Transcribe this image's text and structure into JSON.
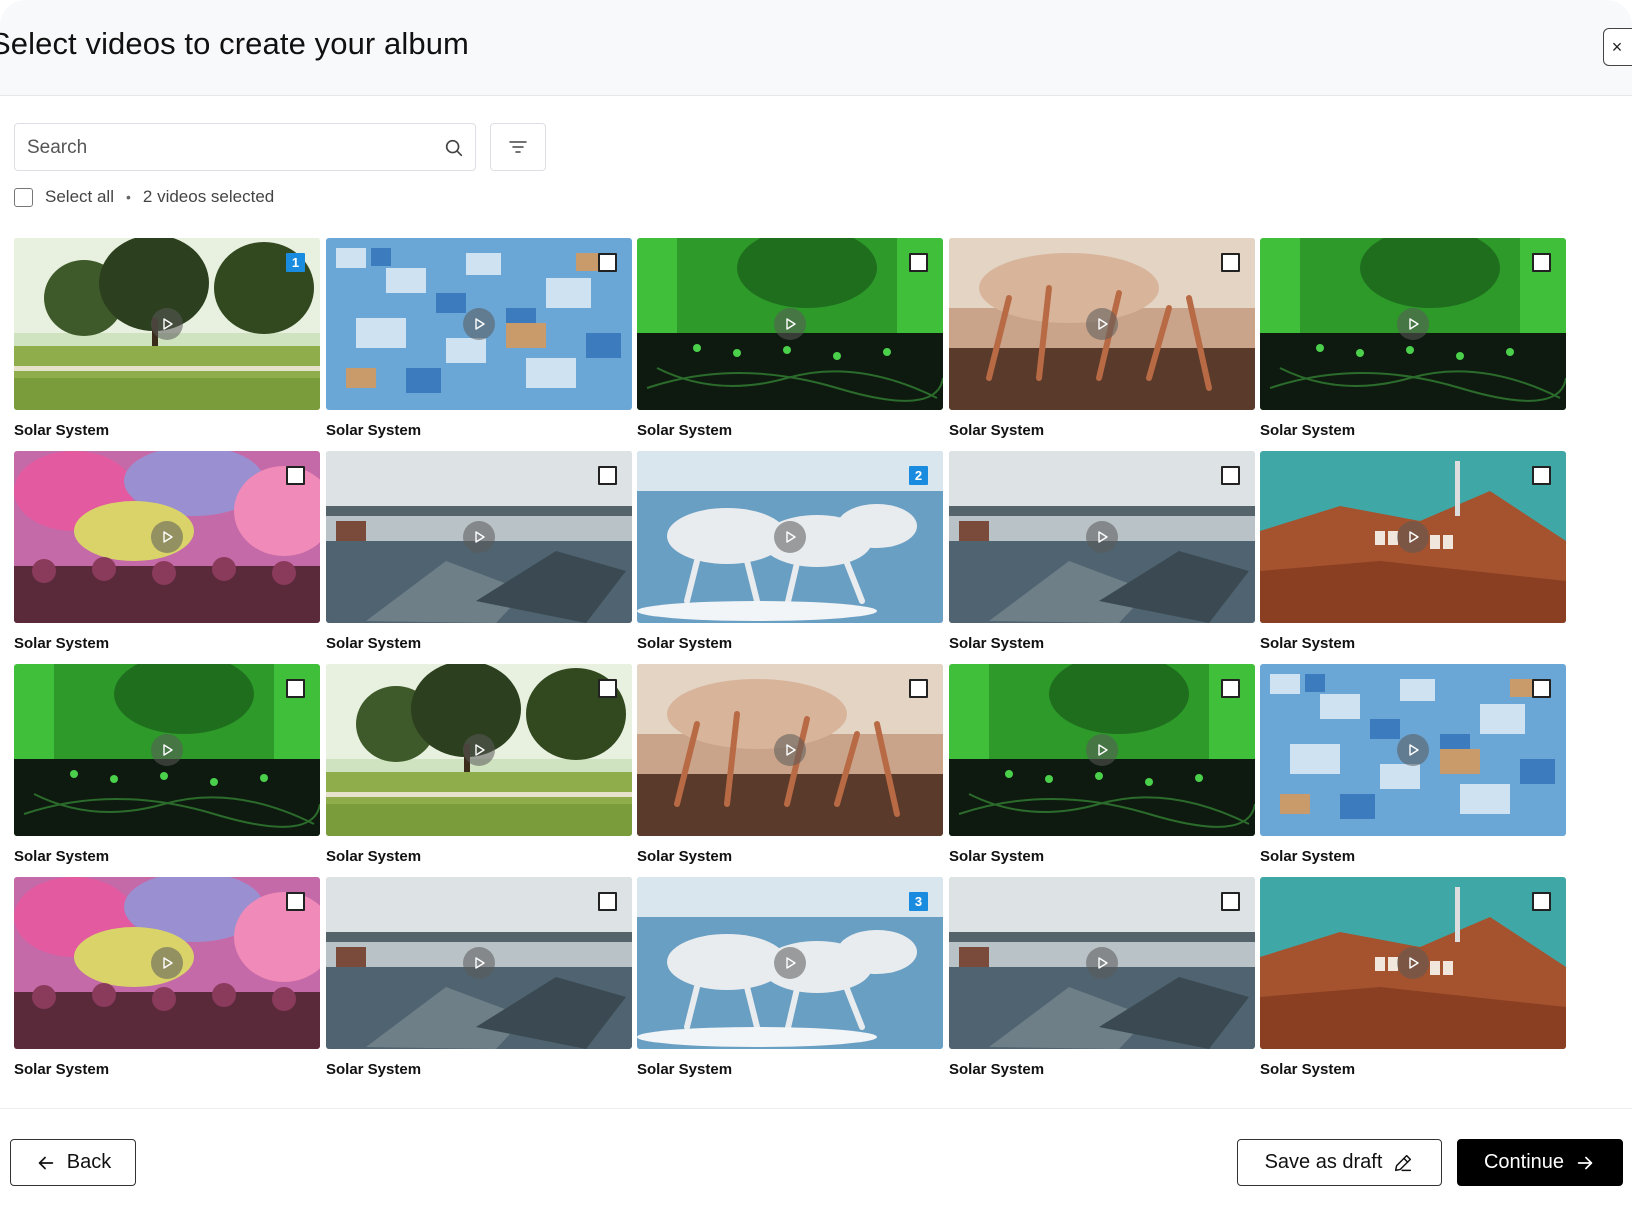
{
  "header": {
    "title": "Select videos to create your album",
    "close_glyph": "×"
  },
  "search": {
    "placeholder": "Search"
  },
  "selection": {
    "select_all_label": "Select all",
    "separator": "•",
    "count_text": "2 videos selected"
  },
  "videos": [
    {
      "title": "Solar System",
      "scene": "park",
      "order": null
    },
    {
      "title": "Solar System",
      "scene": "city",
      "order": null
    },
    {
      "title": "Solar System",
      "scene": "dj",
      "order": null
    },
    {
      "title": "Solar System",
      "scene": "crowd",
      "order": null
    },
    {
      "title": "Solar System",
      "scene": "dj",
      "order": null
    },
    {
      "title": "Solar System",
      "scene": "holi",
      "order": null
    },
    {
      "title": "Solar System",
      "scene": "wreck",
      "order": null
    },
    {
      "title": "Solar System",
      "scene": "horses",
      "order": "2"
    },
    {
      "title": "Solar System",
      "scene": "wreck",
      "order": null
    },
    {
      "title": "Solar System",
      "scene": "hollywood",
      "order": null
    },
    {
      "title": "Solar System",
      "scene": "dj",
      "order": null
    },
    {
      "title": "Solar System",
      "scene": "park",
      "order": null
    },
    {
      "title": "Solar System",
      "scene": "crowd",
      "order": null
    },
    {
      "title": "Solar System",
      "scene": "dj",
      "order": null
    },
    {
      "title": "Solar System",
      "scene": "city",
      "order": null
    },
    {
      "title": "Solar System",
      "scene": "holi",
      "order": null
    },
    {
      "title": "Solar System",
      "scene": "wreck",
      "order": null
    },
    {
      "title": "Solar System",
      "scene": "horses",
      "order": "3"
    },
    {
      "title": "Solar System",
      "scene": "wreck",
      "order": null
    },
    {
      "title": "Solar System",
      "scene": "hollywood",
      "order": null
    }
  ],
  "first_video_order": "1",
  "footer": {
    "back_label": "Back",
    "draft_label": "Save as draft",
    "continue_label": "Continue"
  },
  "colors": {
    "badge": "#1a8ce0",
    "primary_button": "#000000"
  }
}
